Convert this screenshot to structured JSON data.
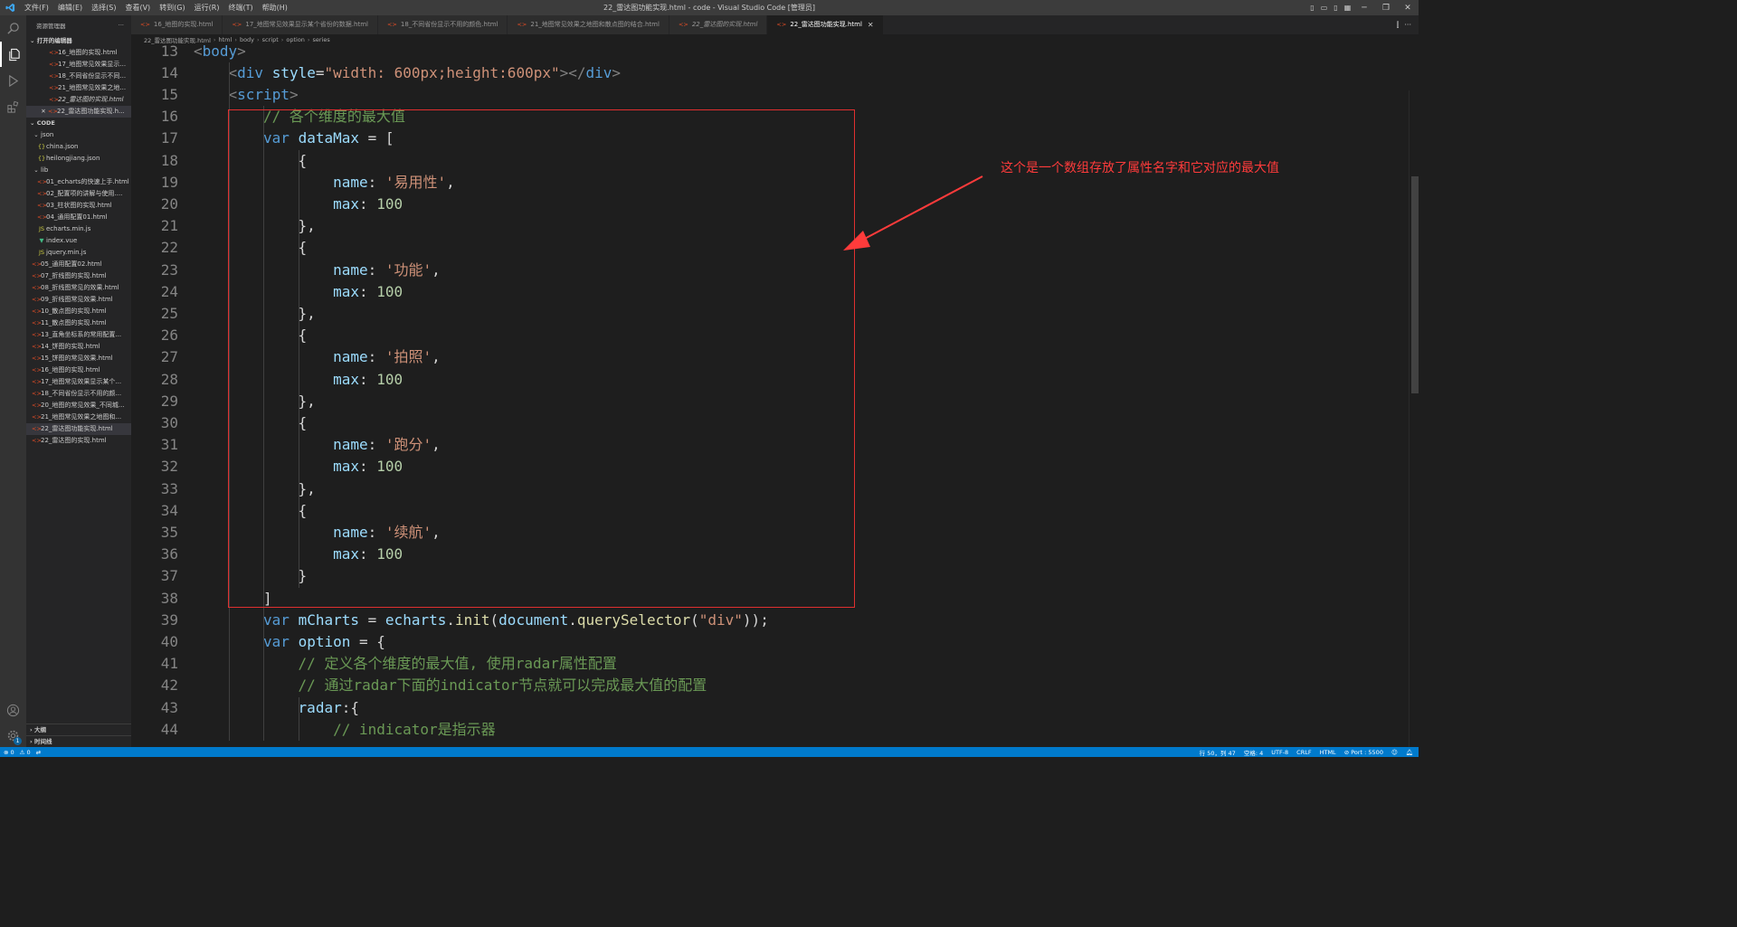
{
  "window": {
    "title": "22_雷达图功能实现.html - code - Visual Studio Code [管理员]",
    "menu": [
      "文件(F)",
      "编辑(E)",
      "选择(S)",
      "查看(V)",
      "转到(G)",
      "运行(R)",
      "终端(T)",
      "帮助(H)"
    ]
  },
  "sidebar": {
    "header": "资源管理器",
    "more": "···",
    "open_editors_title": "打开的编辑器",
    "open_editors": [
      "16_地图的实现.html",
      "17_地图常见效果显示...",
      "18_不同省份显示不同...",
      "21_地图常见效果之地...",
      "22_雷达图的实现.html",
      "22_雷达图功能实现.h..."
    ],
    "folder_title": "CODE",
    "tree": [
      {
        "label": "json",
        "type": "folder",
        "depth": 1
      },
      {
        "label": "china.json",
        "type": "json",
        "depth": 2
      },
      {
        "label": "heilongjiang.json",
        "type": "json",
        "depth": 2
      },
      {
        "label": "lib",
        "type": "folder",
        "depth": 1
      },
      {
        "label": "01_echarts的快速上手.html",
        "type": "html",
        "depth": 2
      },
      {
        "label": "02_配置项的讲解与使用....",
        "type": "html",
        "depth": 2
      },
      {
        "label": "03_柱状图的实现.html",
        "type": "html",
        "depth": 2
      },
      {
        "label": "04_通用配置01.html",
        "type": "html",
        "depth": 2
      },
      {
        "label": "echarts.min.js",
        "type": "js",
        "depth": 2
      },
      {
        "label": "index.vue",
        "type": "vue",
        "depth": 2
      },
      {
        "label": "jquery.min.js",
        "type": "js",
        "depth": 2
      },
      {
        "label": "05_通用配置02.html",
        "type": "html",
        "depth": 1
      },
      {
        "label": "07_折线图的实现.html",
        "type": "html",
        "depth": 1
      },
      {
        "label": "08_折线图常见的效果.html",
        "type": "html",
        "depth": 1
      },
      {
        "label": "09_折线图常见效果.html",
        "type": "html",
        "depth": 1
      },
      {
        "label": "10_散点图的实现.html",
        "type": "html",
        "depth": 1
      },
      {
        "label": "11_散点图的实现.html",
        "type": "html",
        "depth": 1
      },
      {
        "label": "13_直角坐标系的常用配置...",
        "type": "html",
        "depth": 1
      },
      {
        "label": "14_饼图的实现.html",
        "type": "html",
        "depth": 1
      },
      {
        "label": "15_饼图的常见效果.html",
        "type": "html",
        "depth": 1
      },
      {
        "label": "16_地图的实现.html",
        "type": "html",
        "depth": 1
      },
      {
        "label": "17_地图常见效果显示某个...",
        "type": "html",
        "depth": 1
      },
      {
        "label": "18_不同省份显示不用的颜...",
        "type": "html",
        "depth": 1
      },
      {
        "label": "20_地图的常见效果_不同城...",
        "type": "html",
        "depth": 1
      },
      {
        "label": "21_地图常见效果之地图和...",
        "type": "html",
        "depth": 1
      },
      {
        "label": "22_雷达图功能实现.html",
        "type": "html",
        "depth": 1
      },
      {
        "label": "22_雷达图的实现.html",
        "type": "html",
        "depth": 1
      }
    ],
    "outline_title": "大纲",
    "timeline_title": "时间线"
  },
  "tabs": [
    {
      "label": "16_地图的实现.html",
      "active": false,
      "italic": false
    },
    {
      "label": "17_地图常见效果显示某个省份的数据.html",
      "active": false,
      "italic": false
    },
    {
      "label": "18_不同省份显示不用的颜色.html",
      "active": false,
      "italic": false
    },
    {
      "label": "21_地图常见效果之地图和散点图的结合.html",
      "active": false,
      "italic": false
    },
    {
      "label": "22_雷达图的实现.html",
      "active": false,
      "italic": true
    },
    {
      "label": "22_雷达图功能实现.html",
      "active": true,
      "italic": false
    }
  ],
  "breadcrumb": [
    "22_雷达图功能实现.html",
    "html",
    "body",
    "script",
    "option",
    "series"
  ],
  "editor": {
    "lines": [
      {
        "n": "13",
        "indent": 0,
        "html": "<span class=\"br\">&lt;</span><span class=\"t\">body</span><span class=\"br\">&gt;</span>"
      },
      {
        "n": "14",
        "indent": 1,
        "html": "<span class=\"br\">&lt;</span><span class=\"t\">div</span> <span class=\"at\">style</span><span class=\"d\">=</span><span class=\"s\">\"width: 600px;height:600px\"</span><span class=\"br\">&gt;&lt;/</span><span class=\"t\">div</span><span class=\"br\">&gt;</span>"
      },
      {
        "n": "15",
        "indent": 1,
        "html": "<span class=\"br\">&lt;</span><span class=\"t\">script</span><span class=\"br\">&gt;</span>"
      },
      {
        "n": "16",
        "indent": 2,
        "html": "<span class=\"c\">// 各个维度的最大值</span>"
      },
      {
        "n": "17",
        "indent": 2,
        "html": "<span class=\"k\">var</span> <span class=\"v\">dataMax</span> <span class=\"d\">= [</span>"
      },
      {
        "n": "18",
        "indent": 3,
        "html": "<span class=\"d\">{</span>"
      },
      {
        "n": "19",
        "indent": 4,
        "html": "<span class=\"p\">name</span><span class=\"d\">: </span><span class=\"s\">'易用性'</span><span class=\"d\">,</span>"
      },
      {
        "n": "20",
        "indent": 4,
        "html": "<span class=\"p\">max</span><span class=\"d\">: </span><span class=\"n\">100</span>"
      },
      {
        "n": "21",
        "indent": 3,
        "html": "<span class=\"d\">},</span>"
      },
      {
        "n": "22",
        "indent": 3,
        "html": "<span class=\"d\">{</span>"
      },
      {
        "n": "23",
        "indent": 4,
        "html": "<span class=\"p\">name</span><span class=\"d\">: </span><span class=\"s\">'功能'</span><span class=\"d\">,</span>"
      },
      {
        "n": "24",
        "indent": 4,
        "html": "<span class=\"p\">max</span><span class=\"d\">: </span><span class=\"n\">100</span>"
      },
      {
        "n": "25",
        "indent": 3,
        "html": "<span class=\"d\">},</span>"
      },
      {
        "n": "26",
        "indent": 3,
        "html": "<span class=\"d\">{</span>"
      },
      {
        "n": "27",
        "indent": 4,
        "html": "<span class=\"p\">name</span><span class=\"d\">: </span><span class=\"s\">'拍照'</span><span class=\"d\">,</span>"
      },
      {
        "n": "28",
        "indent": 4,
        "html": "<span class=\"p\">max</span><span class=\"d\">: </span><span class=\"n\">100</span>"
      },
      {
        "n": "29",
        "indent": 3,
        "html": "<span class=\"d\">},</span>"
      },
      {
        "n": "30",
        "indent": 3,
        "html": "<span class=\"d\">{</span>"
      },
      {
        "n": "31",
        "indent": 4,
        "html": "<span class=\"p\">name</span><span class=\"d\">: </span><span class=\"s\">'跑分'</span><span class=\"d\">,</span>"
      },
      {
        "n": "32",
        "indent": 4,
        "html": "<span class=\"p\">max</span><span class=\"d\">: </span><span class=\"n\">100</span>"
      },
      {
        "n": "33",
        "indent": 3,
        "html": "<span class=\"d\">},</span>"
      },
      {
        "n": "34",
        "indent": 3,
        "html": "<span class=\"d\">{</span>"
      },
      {
        "n": "35",
        "indent": 4,
        "html": "<span class=\"p\">name</span><span class=\"d\">: </span><span class=\"s\">'续航'</span><span class=\"d\">,</span>"
      },
      {
        "n": "36",
        "indent": 4,
        "html": "<span class=\"p\">max</span><span class=\"d\">: </span><span class=\"n\">100</span>"
      },
      {
        "n": "37",
        "indent": 3,
        "html": "<span class=\"d\">}</span>"
      },
      {
        "n": "38",
        "indent": 2,
        "html": "<span class=\"d\">]</span>"
      },
      {
        "n": "39",
        "indent": 2,
        "html": "<span class=\"k\">var</span> <span class=\"v\">mCharts</span> <span class=\"d\">= </span><span class=\"v\">echarts</span><span class=\"d\">.</span><span class=\"f\">init</span><span class=\"d\">(</span><span class=\"v\">document</span><span class=\"d\">.</span><span class=\"f\">querySelector</span><span class=\"d\">(</span><span class=\"s\">\"div\"</span><span class=\"d\">));</span>"
      },
      {
        "n": "40",
        "indent": 2,
        "html": "<span class=\"k\">var</span> <span class=\"v\">option</span> <span class=\"d\">= {</span>"
      },
      {
        "n": "41",
        "indent": 3,
        "html": "<span class=\"c\">// 定义各个维度的最大值, 使用radar属性配置</span>"
      },
      {
        "n": "42",
        "indent": 3,
        "html": "<span class=\"c\">// 通过radar下面的indicator节点就可以完成最大值的配置</span>"
      },
      {
        "n": "43",
        "indent": 3,
        "html": "<span class=\"p\">radar</span><span class=\"d\">:{</span>"
      },
      {
        "n": "44",
        "indent": 4,
        "html": "<span class=\"c\">// indicator是指示器</span>"
      }
    ]
  },
  "annotation": {
    "text": "这个是一个数组存放了属性名字和它对应的最大值",
    "color": "#ff3b3b"
  },
  "status": {
    "errors": "⊗ 0",
    "warnings": "⚠ 0",
    "position": "行 50，列 47",
    "spaces": "空格: 4",
    "encoding": "UTF-8",
    "eol": "CRLF",
    "language": "HTML",
    "port": "⊘ Port : 5500"
  },
  "colors": {
    "accent": "#007acc",
    "editor_bg": "#1e1e1e",
    "sidebar_bg": "#252526",
    "highlight_box": "#e03030"
  }
}
